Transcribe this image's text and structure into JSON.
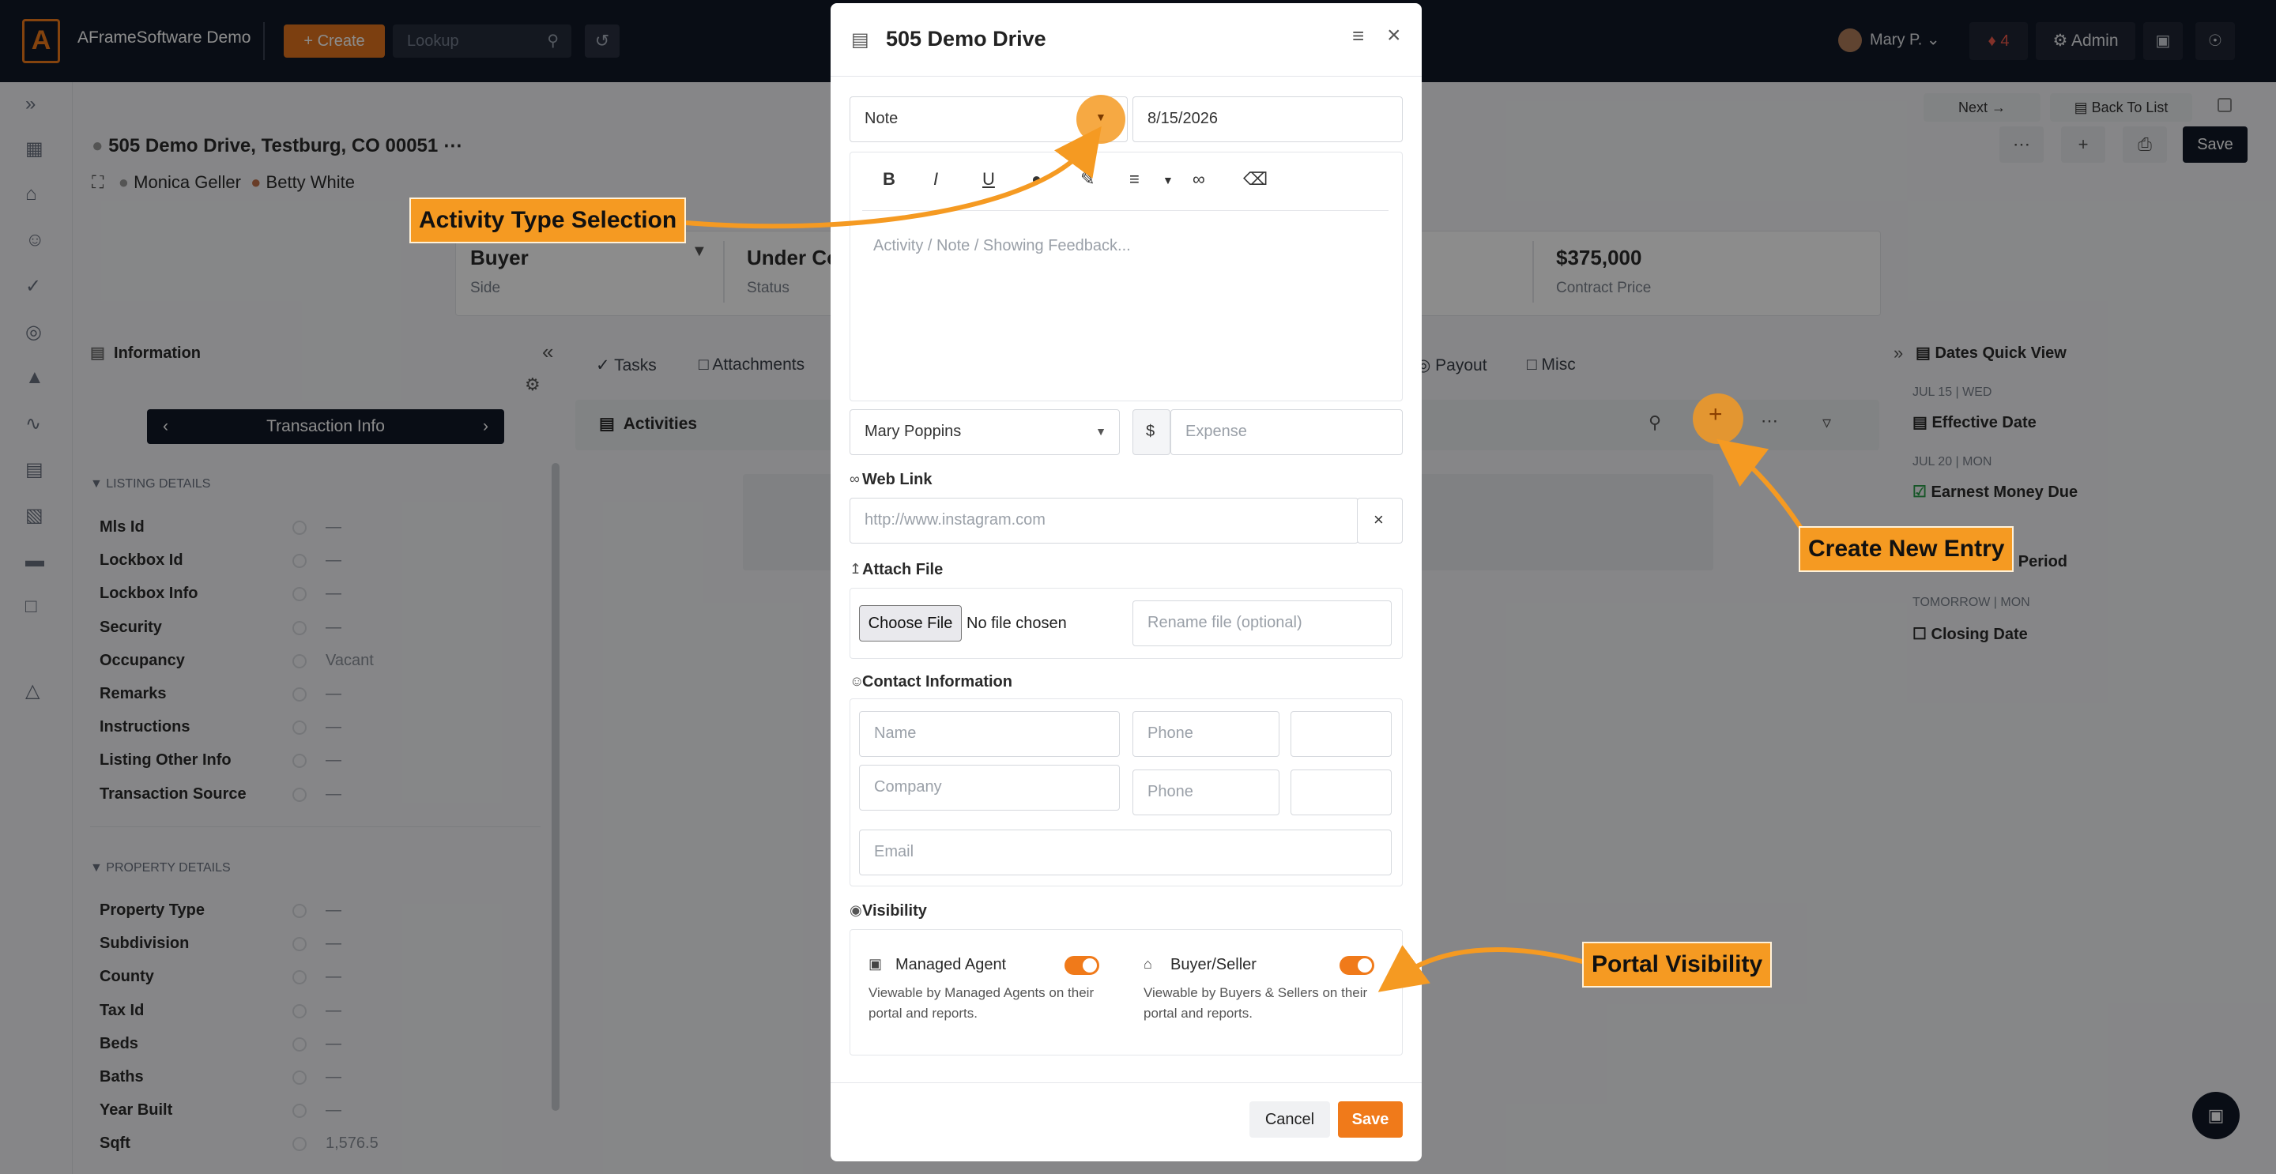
{
  "topbar": {
    "logo": "A",
    "app_name": "AFrameSoftware Demo",
    "create_label": "+ Create",
    "lookup_placeholder": "Lookup",
    "user_name": "Mary P.",
    "notif_count": "4",
    "admin_label": "Admin"
  },
  "page": {
    "property_title": "505 Demo Drive, Testburg, CO 00051",
    "contact_1": "Monica Geller",
    "contact_2": "Betty White",
    "next_label": "Next",
    "back_label": "Back To List",
    "save_label": "Save",
    "summary": [
      {
        "value": "Buyer",
        "label": "Side"
      },
      {
        "value": "Under Co",
        "label": "Status"
      },
      {
        "value": "$375,000",
        "label": "Contract Price"
      }
    ]
  },
  "info": {
    "heading": "Information",
    "nav_label": "Transaction Info",
    "listing_section": "LISTING DETAILS",
    "listing_fields": [
      {
        "label": "Mls Id",
        "value": "—"
      },
      {
        "label": "Lockbox Id",
        "value": "—"
      },
      {
        "label": "Lockbox Info",
        "value": "—"
      },
      {
        "label": "Security",
        "value": "—"
      },
      {
        "label": "Occupancy",
        "value": "Vacant"
      },
      {
        "label": "Remarks",
        "value": "—"
      },
      {
        "label": "Instructions",
        "value": "—"
      },
      {
        "label": "Listing Other Info",
        "value": "—"
      },
      {
        "label": "Transaction Source",
        "value": "—"
      }
    ],
    "property_section": "PROPERTY DETAILS",
    "property_fields": [
      {
        "label": "Property Type",
        "value": "—"
      },
      {
        "label": "Subdivision",
        "value": "—"
      },
      {
        "label": "County",
        "value": "—"
      },
      {
        "label": "Tax Id",
        "value": "—"
      },
      {
        "label": "Beds",
        "value": "—"
      },
      {
        "label": "Baths",
        "value": "—"
      },
      {
        "label": "Year Built",
        "value": "—"
      },
      {
        "label": "Sqft",
        "value": "1,576.5"
      }
    ]
  },
  "tabs": {
    "tasks": "Tasks",
    "attachments": "Attachments",
    "payout": "Payout",
    "misc": "Misc",
    "activities": "Activities"
  },
  "dates": {
    "heading": "Dates Quick View",
    "items": [
      {
        "when": "JUL 15 | WED",
        "name": "Effective Date"
      },
      {
        "when": "JUL 20 | MON",
        "name": "Earnest Money Due"
      },
      {
        "when": "",
        "name": "n Period"
      },
      {
        "when": "TOMORROW | MON",
        "name": "Closing Date"
      }
    ]
  },
  "modal": {
    "title": "505 Demo Drive",
    "type_value": "Note",
    "date_value": "8/15/2026",
    "editor_placeholder": "Activity / Note / Showing Feedback...",
    "assignee_value": "Mary Poppins",
    "currency": "$",
    "expense_placeholder": "Expense",
    "weblink_label": "Web Link",
    "weblink_placeholder": "http://www.instagram.com",
    "attach_label": "Attach File",
    "choose_file": "Choose File",
    "no_file": "No file chosen",
    "rename_placeholder": "Rename file (optional)",
    "contact_label": "Contact Information",
    "name_placeholder": "Name",
    "phone_placeholder": "Phone",
    "company_placeholder": "Company",
    "email_placeholder": "Email",
    "visibility_label": "Visibility",
    "managed_agent": "Managed Agent",
    "managed_agent_desc": "Viewable by Managed Agents on their portal and reports.",
    "buyer_seller": "Buyer/Seller",
    "buyer_seller_desc": "Viewable by Buyers & Sellers on their portal and reports.",
    "cancel_label": "Cancel",
    "save_label": "Save"
  },
  "callouts": {
    "activity_type": "Activity Type Selection",
    "create_new": "Create New Entry",
    "portal_visibility": "Portal Visibility"
  },
  "colors": {
    "accent": "#f07a1a",
    "dark": "#111827"
  }
}
